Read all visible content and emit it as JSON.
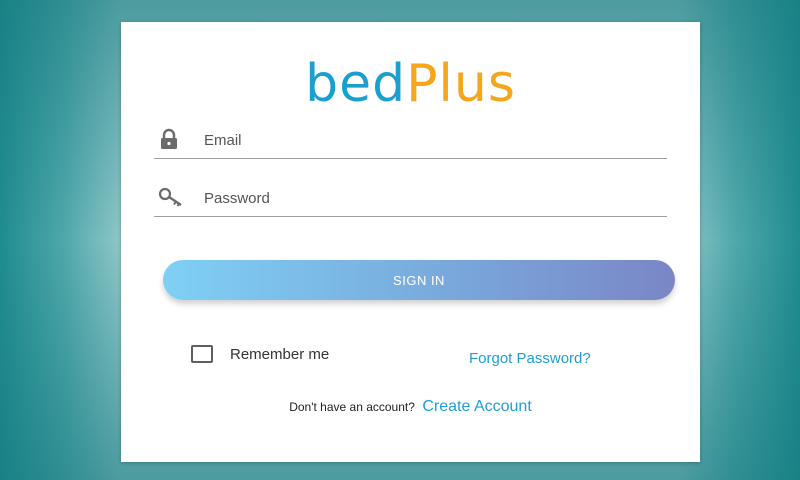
{
  "logo": {
    "part1": "bed",
    "part2": "Plus"
  },
  "email": {
    "placeholder": "Email",
    "icon": "lock-icon"
  },
  "password": {
    "placeholder": "Password",
    "icon": "key-icon"
  },
  "signin": {
    "label": "SIGN IN"
  },
  "remember": {
    "label": "Remember me",
    "checked": false
  },
  "forgot": {
    "label": "Forgot Password?"
  },
  "signup": {
    "prompt": "Don't have an account?",
    "link": "Create Account"
  },
  "colors": {
    "brand_blue": "#1b9fcf",
    "brand_orange": "#f6a61b",
    "link": "#1e9fd6",
    "button_start": "#7fd0f5",
    "button_end": "#7a86c6",
    "background": "#2a9196"
  }
}
